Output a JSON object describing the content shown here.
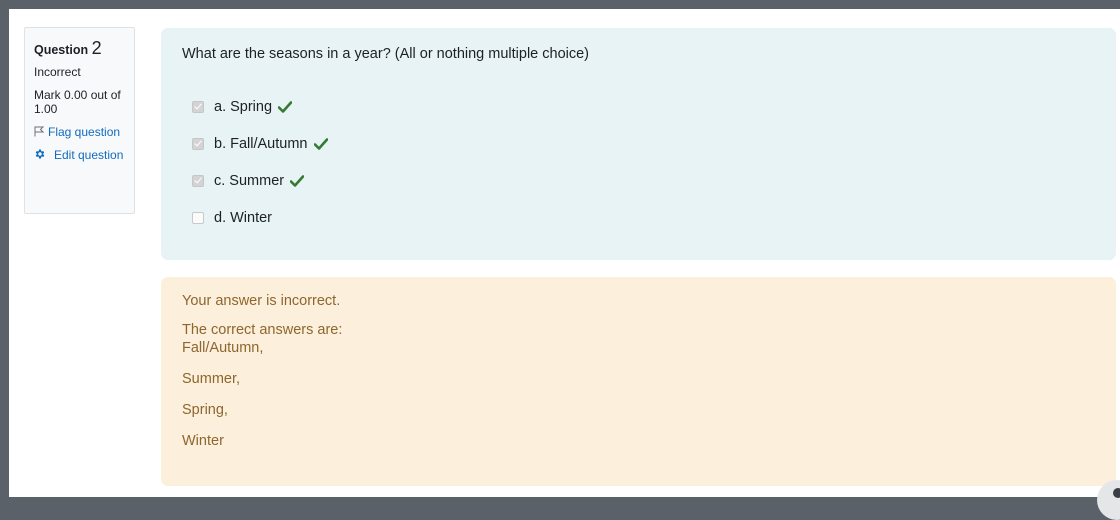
{
  "question_info": {
    "label": "Question",
    "number": "2",
    "state": "Incorrect",
    "grade": "Mark 0.00 out of 1.00",
    "flag_label": "Flag question",
    "edit_label": "Edit question"
  },
  "formulation": {
    "question_text": "What are the seasons in a year?  (All or nothing multiple choice)",
    "options": [
      {
        "label": "a. Spring",
        "checked": true,
        "correct_mark": true
      },
      {
        "label": "b. Fall/Autumn",
        "checked": true,
        "correct_mark": true
      },
      {
        "label": "c. Summer",
        "checked": true,
        "correct_mark": true
      },
      {
        "label": "d. Winter",
        "checked": false,
        "correct_mark": false
      }
    ]
  },
  "feedback": {
    "result": "Your answer is incorrect.",
    "intro": "The correct answers are:",
    "answers": [
      "Fall/Autumn,",
      "Summer,",
      "Spring,",
      "Winter"
    ]
  },
  "colors": {
    "link": "#0f6cbf",
    "correct_tick": "#357a32",
    "formulation_bg": "#e7f3f5",
    "feedback_bg": "#fcefdc",
    "feedback_text": "#8e662e"
  }
}
